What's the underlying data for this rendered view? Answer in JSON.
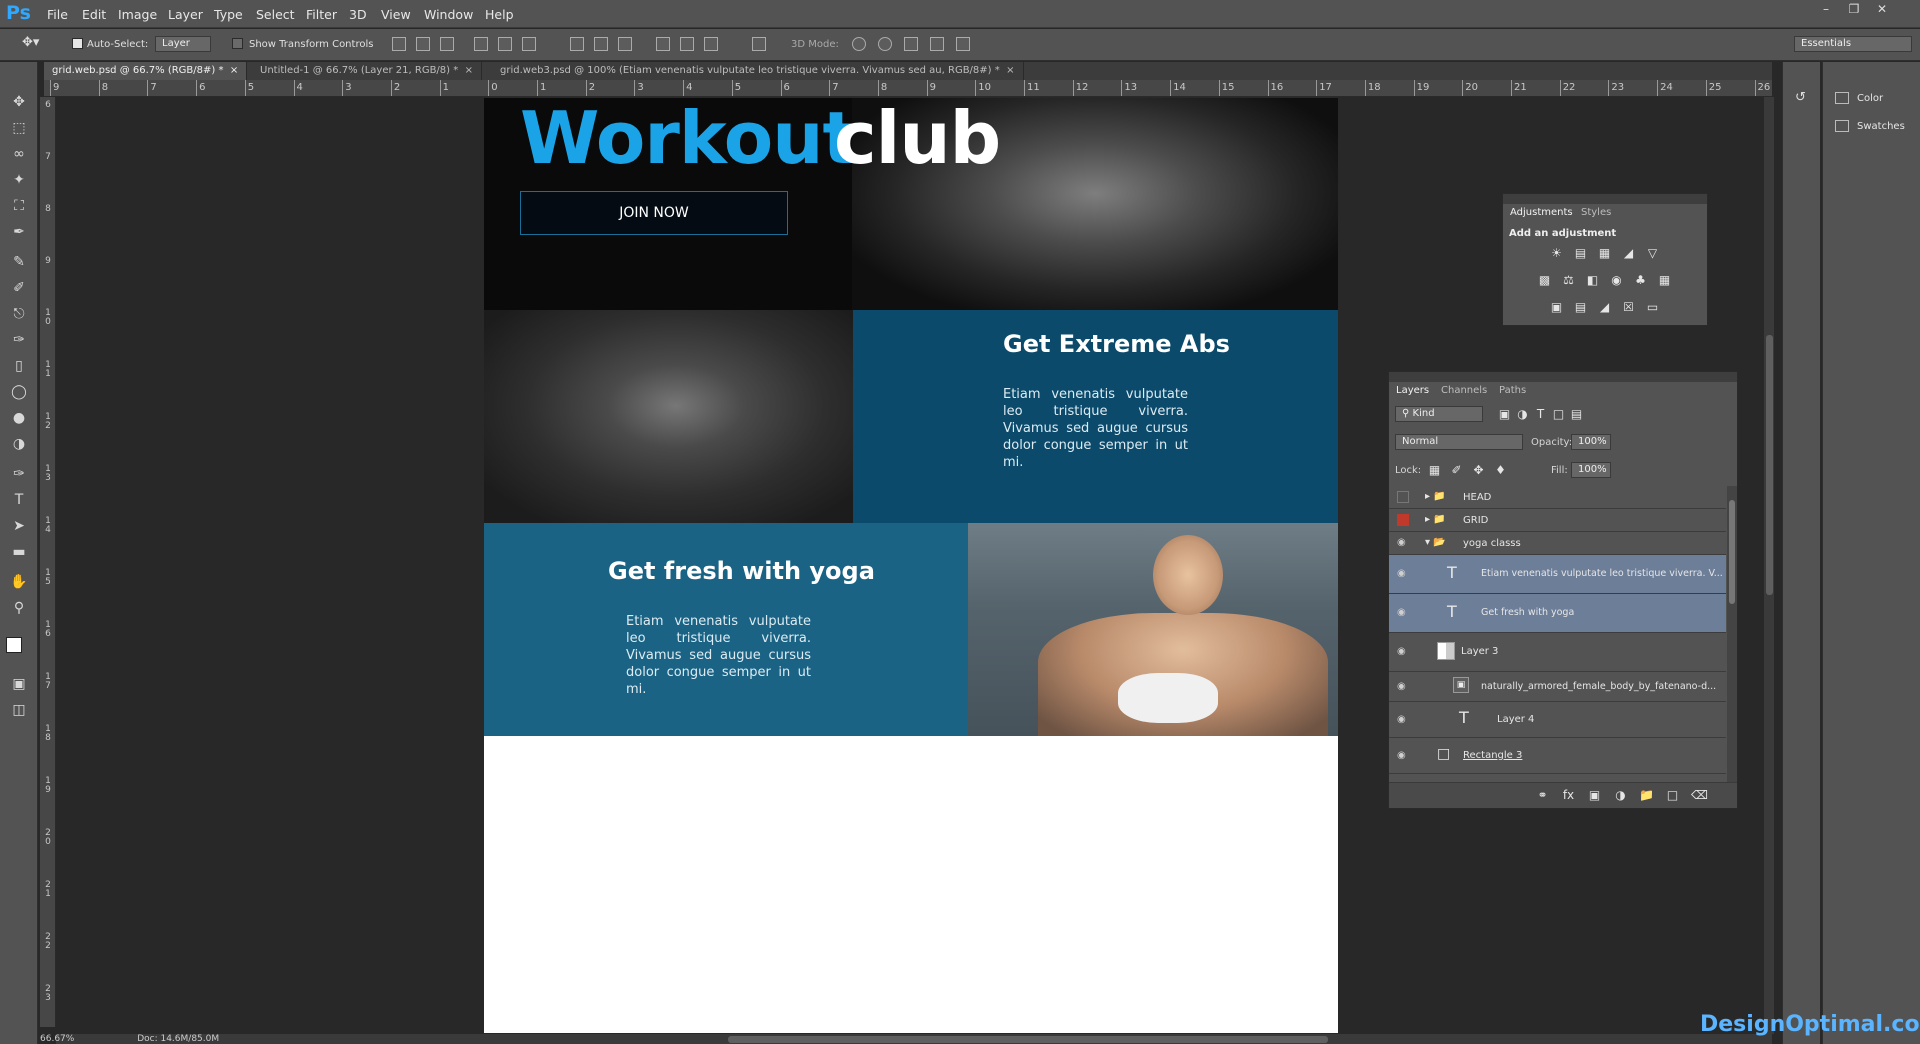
{
  "app": {
    "logo": "Ps"
  },
  "menu": [
    "File",
    "Edit",
    "Image",
    "Layer",
    "Type",
    "Select",
    "Filter",
    "3D",
    "View",
    "Window",
    "Help"
  ],
  "options": {
    "auto_select_label": "Auto-Select:",
    "auto_select_value": "Layer",
    "transform_label": "Show Transform Controls",
    "mode3d_label": "3D Mode:",
    "workspace": "Essentials"
  },
  "tabs": [
    {
      "label": "grid.web.psd @ 66.7% (RGB/8#) *"
    },
    {
      "label": "Untitled-1 @ 66.7% (Layer 21, RGB/8) *"
    },
    {
      "label": "grid.web3.psd @ 100% (Etiam venenatis vulputate leo tristique viverra. Vivamus sed au, RGB/8#) *"
    }
  ],
  "ruler_h": [
    "9",
    "8",
    "7",
    "6",
    "5",
    "4",
    "3",
    "2",
    "1",
    "0",
    "1",
    "2",
    "3",
    "4",
    "5",
    "6",
    "7",
    "8",
    "9",
    "10",
    "11",
    "12",
    "13",
    "14",
    "15",
    "16",
    "17",
    "18",
    "19",
    "20",
    "21",
    "22",
    "23",
    "24",
    "25",
    "26"
  ],
  "ruler_v": [
    "6",
    "7",
    "8",
    "9",
    "10",
    "11",
    "12",
    "13",
    "14",
    "15",
    "16",
    "17",
    "18",
    "19",
    "20",
    "21",
    "22",
    "23"
  ],
  "document": {
    "hero_title_blue": "Workout",
    "hero_title_white": "club",
    "join_button": "JOIN NOW",
    "abs_title": "Get Extreme Abs",
    "abs_body": "Etiam venenatis vulputate leo tristique viverra. Vivamus sed augue cursus dolor congue semper in ut mi.",
    "yoga_title": "Get fresh with yoga",
    "yoga_body": "Etiam venenatis vulputate leo tristique viverra. Vivamus sed augue cursus dolor congue semper in ut mi."
  },
  "status": {
    "zoom": "66.67%",
    "doc": "Doc: 14.6M/85.0M"
  },
  "dock": [
    {
      "label": "Color",
      "icon": "color-icon"
    },
    {
      "label": "Swatches",
      "icon": "swatches-icon"
    }
  ],
  "adjustments": {
    "tabs": [
      "Adjustments",
      "Styles"
    ],
    "heading": "Add an adjustment"
  },
  "layers_panel": {
    "tabs": [
      "Layers",
      "Channels",
      "Paths"
    ],
    "filter": "Kind",
    "blend_mode": "Normal",
    "opacity_label": "Opacity:",
    "opacity_value": "100%",
    "lock_label": "Lock:",
    "fill_label": "Fill:",
    "fill_value": "100%",
    "layers": [
      {
        "name": "HEAD",
        "type": "group",
        "selected": false
      },
      {
        "name": "GRID",
        "type": "group",
        "selected": false
      },
      {
        "name": "yoga classs",
        "type": "group-open",
        "selected": false
      },
      {
        "name": "Etiam venenatis vulputate leo tristique viverra. V...",
        "type": "text",
        "selected": true
      },
      {
        "name": "Get fresh with yoga",
        "type": "text",
        "selected": true
      },
      {
        "name": "Layer 3",
        "type": "pixel",
        "selected": false
      },
      {
        "name": "naturally_armored_female_body_by_fatenano-d...",
        "type": "smart",
        "selected": false
      },
      {
        "name": "Layer 4",
        "type": "text",
        "selected": false
      },
      {
        "name": "Rectangle 3",
        "type": "shape",
        "selected": false
      }
    ]
  },
  "watermark": "DesignOptimal.com"
}
